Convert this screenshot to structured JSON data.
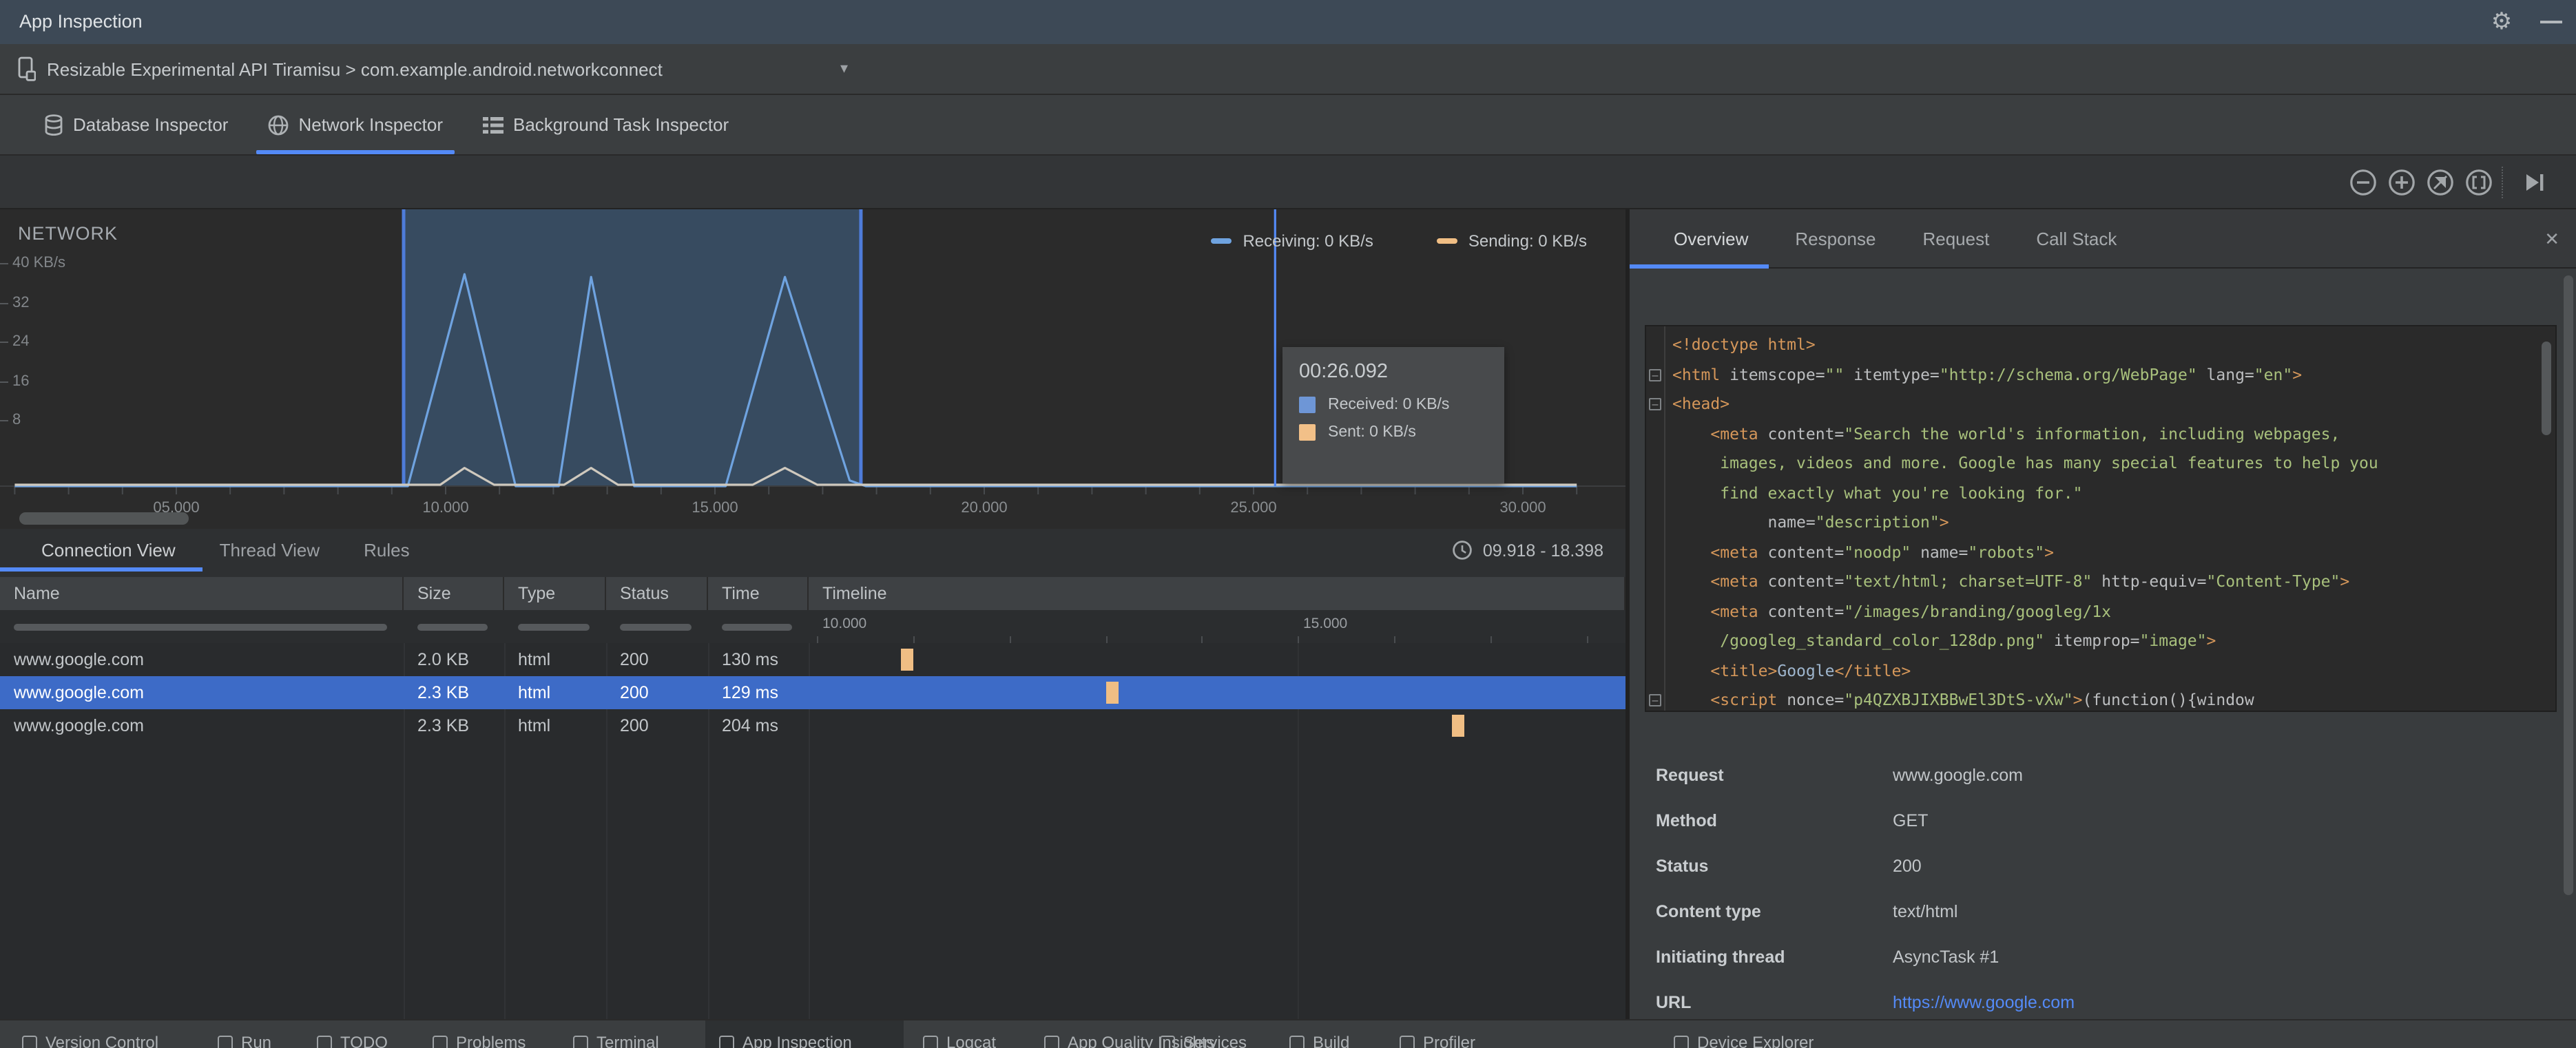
{
  "window": {
    "title": "App Inspection",
    "gear_icon": "settings-gear",
    "minimize_icon": "hide-window"
  },
  "device_bar": {
    "label": "Resizable Experimental API Tiramisu > com.example.android.networkconnect",
    "chevron": "▾"
  },
  "inspector_tabs": [
    {
      "label": "Database Inspector",
      "icon": "database-icon",
      "active": false
    },
    {
      "label": "Network Inspector",
      "icon": "globe-icon",
      "active": true
    },
    {
      "label": "Background Task Inspector",
      "icon": "task-list-icon",
      "active": false
    }
  ],
  "zoom_toolbar": [
    {
      "name": "zoom-out",
      "glyph": "minus-circle"
    },
    {
      "name": "zoom-in",
      "glyph": "plus-circle"
    },
    {
      "name": "reset-zoom",
      "glyph": "reset-circle"
    },
    {
      "name": "zoom-to-selection",
      "glyph": "brackets-circle"
    },
    {
      "name": "jump-to-live",
      "glyph": "skip-end"
    }
  ],
  "chart_data": {
    "type": "area-line",
    "title": "NETWORK",
    "ylabel": "KB/s",
    "y_ticks": [
      "40 KB/s",
      "32",
      "24",
      "16",
      "8"
    ],
    "ylim": [
      0,
      40
    ],
    "x_ticks": [
      {
        "label": "05.000",
        "t": 5
      },
      {
        "label": "10.000",
        "t": 10
      },
      {
        "label": "15.000",
        "t": 15
      },
      {
        "label": "20.000",
        "t": 20
      },
      {
        "label": "25.000",
        "t": 25
      },
      {
        "label": "30.000",
        "t": 30
      }
    ],
    "legend": [
      {
        "name": "receiving",
        "label": "Receiving: 0 KB/s",
        "color": "#6fa3e0"
      },
      {
        "name": "sending",
        "label": "Sending: 0 KB/s",
        "color": "#f0be84"
      }
    ],
    "series": [
      {
        "name": "received_kbps",
        "color": "#6fa3e0",
        "points": [
          [
            2,
            0
          ],
          [
            9.3,
            0
          ],
          [
            10.35,
            38
          ],
          [
            11.3,
            0
          ],
          [
            12.1,
            0
          ],
          [
            12.7,
            37.5
          ],
          [
            13.5,
            0
          ],
          [
            15.2,
            0
          ],
          [
            16.3,
            37.5
          ],
          [
            17.5,
            1
          ],
          [
            17.8,
            0
          ],
          [
            31,
            0
          ]
        ]
      },
      {
        "name": "sent_kbps",
        "color": "#cfc9be",
        "points": [
          [
            2,
            0
          ],
          [
            9.9,
            0
          ],
          [
            10.35,
            3
          ],
          [
            10.9,
            0
          ],
          [
            12.2,
            0
          ],
          [
            12.7,
            3
          ],
          [
            13.2,
            0
          ],
          [
            15.7,
            0
          ],
          [
            16.3,
            3
          ],
          [
            16.9,
            0
          ],
          [
            31,
            0
          ]
        ]
      }
    ],
    "selection": {
      "start_s": 9.22,
      "end_s": 17.71
    },
    "crosshair_s": 25.4,
    "tooltip": {
      "time": "00:26.092",
      "rows": [
        {
          "label": "Received: 0 KB/s",
          "color": "#6e96d6"
        },
        {
          "label": "Sent: 0 KB/s",
          "color": "#f2c088"
        }
      ]
    }
  },
  "connection_panel": {
    "tabs": [
      {
        "label": "Connection View",
        "active": true
      },
      {
        "label": "Thread View",
        "active": false
      },
      {
        "label": "Rules",
        "active": false
      }
    ],
    "range": "09.918 - 18.398",
    "range_icon": "clock-icon",
    "table": {
      "columns": [
        "Name",
        "Size",
        "Type",
        "Status",
        "Time",
        "Timeline"
      ],
      "ruler_labels": [
        {
          "label": "10.000",
          "t": 10
        },
        {
          "label": "15.000",
          "t": 15
        }
      ],
      "ruler_range": [
        9.918,
        18.398
      ],
      "rows": [
        {
          "name": "www.google.com",
          "size": "2.0 KB",
          "type": "html",
          "status": "200",
          "time": "130 ms",
          "bar_s": 10.87,
          "selected": false
        },
        {
          "name": "www.google.com",
          "size": "2.3 KB",
          "type": "html",
          "status": "200",
          "time": "129 ms",
          "bar_s": 13.0,
          "selected": true
        },
        {
          "name": "www.google.com",
          "size": "2.3 KB",
          "type": "html",
          "status": "200",
          "time": "204 ms",
          "bar_s": 16.6,
          "selected": false
        }
      ]
    }
  },
  "detail_panel": {
    "tabs": [
      {
        "label": "Overview",
        "active": true
      },
      {
        "label": "Response",
        "active": false
      },
      {
        "label": "Request",
        "active": false
      },
      {
        "label": "Call Stack",
        "active": false
      }
    ],
    "close_label": "✕",
    "code_lines": [
      [
        [
          "tag",
          "<!doctype html>"
        ]
      ],
      [
        [
          "tag",
          "<html"
        ],
        [
          "plain",
          " itemscope="
        ],
        [
          "str",
          "\"\""
        ],
        [
          "plain",
          " itemtype="
        ],
        [
          "str",
          "\"http://schema.org/WebPage\""
        ],
        [
          "plain",
          " lang="
        ],
        [
          "str",
          "\"en\""
        ],
        [
          "tag",
          ">"
        ]
      ],
      [
        [
          "tag",
          "<head>"
        ]
      ],
      [
        [
          "plain",
          "    "
        ],
        [
          "tag",
          "<meta"
        ],
        [
          "plain",
          " content="
        ],
        [
          "str",
          "\"Search the world's information, including webpages,"
        ]
      ],
      [
        [
          "str",
          "     images, videos and more. Google has many special features to help you"
        ]
      ],
      [
        [
          "str",
          "     find exactly what you're looking for.\""
        ]
      ],
      [
        [
          "plain",
          "          name="
        ],
        [
          "str",
          "\"description\""
        ],
        [
          "tag",
          ">"
        ]
      ],
      [
        [
          "plain",
          "    "
        ],
        [
          "tag",
          "<meta"
        ],
        [
          "plain",
          " content="
        ],
        [
          "str",
          "\"noodp\""
        ],
        [
          "plain",
          " name="
        ],
        [
          "str",
          "\"robots\""
        ],
        [
          "tag",
          ">"
        ]
      ],
      [
        [
          "plain",
          "    "
        ],
        [
          "tag",
          "<meta"
        ],
        [
          "plain",
          " content="
        ],
        [
          "str",
          "\"text/html; charset=UTF-8\""
        ],
        [
          "plain",
          " http-equiv="
        ],
        [
          "str",
          "\"Content-Type\""
        ],
        [
          "tag",
          ">"
        ]
      ],
      [
        [
          "plain",
          "    "
        ],
        [
          "tag",
          "<meta"
        ],
        [
          "plain",
          " content="
        ],
        [
          "str",
          "\"/images/branding/googleg/1x"
        ]
      ],
      [
        [
          "str",
          "     /googleg_standard_color_128dp.png\""
        ],
        [
          "plain",
          " itemprop="
        ],
        [
          "str",
          "\"image\""
        ],
        [
          "tag",
          ">"
        ]
      ],
      [
        [
          "plain",
          "    "
        ],
        [
          "tag",
          "<title>"
        ],
        [
          "text",
          "Google"
        ],
        [
          "tag",
          "</title>"
        ]
      ],
      [
        [
          "plain",
          "    "
        ],
        [
          "tag",
          "<script"
        ],
        [
          "plain",
          " nonce="
        ],
        [
          "str",
          "\"p4QZXBJIXBBwEl3DtS-vXw\""
        ],
        [
          "tag",
          ">"
        ],
        [
          "plain",
          "(function(){window"
        ]
      ]
    ],
    "fold_lines": [
      1,
      2,
      12
    ],
    "fields": [
      {
        "label": "Request",
        "value": "www.google.com",
        "link": false
      },
      {
        "label": "Method",
        "value": "GET",
        "link": false
      },
      {
        "label": "Status",
        "value": "200",
        "link": false
      },
      {
        "label": "Content type",
        "value": "text/html",
        "link": false
      },
      {
        "label": "Initiating thread",
        "value": "AsyncTask #1",
        "link": false
      },
      {
        "label": "URL",
        "value": "https://www.google.com",
        "link": true
      }
    ]
  },
  "bottom_bar": {
    "items": [
      {
        "label": "Version Control",
        "icon": "branch-icon",
        "active": false
      },
      {
        "label": "Run",
        "icon": "run-icon",
        "active": false
      },
      {
        "label": "TODO",
        "icon": "todo-icon",
        "active": false
      },
      {
        "label": "Problems",
        "icon": "problems-icon",
        "active": false
      },
      {
        "label": "Terminal",
        "icon": "terminal-icon",
        "active": false
      },
      {
        "label": "App Inspection",
        "icon": "inspection-icon",
        "active": true
      },
      {
        "label": "Logcat",
        "icon": "logcat-icon",
        "active": false
      },
      {
        "label": "App Quality Insights",
        "icon": "insights-icon",
        "active": false
      },
      {
        "label": "Services",
        "icon": "services-icon",
        "active": false
      },
      {
        "label": "Build",
        "icon": "build-icon",
        "active": false
      },
      {
        "label": "Profiler",
        "icon": "profiler-icon",
        "active": false
      },
      {
        "label": "Device Explorer",
        "icon": "device-icon",
        "active": false
      }
    ]
  }
}
